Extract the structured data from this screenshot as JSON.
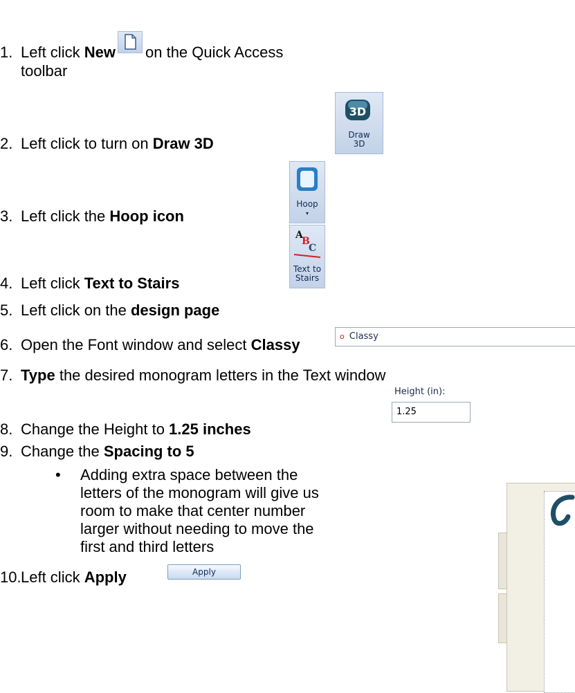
{
  "steps": [
    {
      "num": "1.",
      "pre": "Left click ",
      "bold": "New",
      "post": " on the Quick Access"
    },
    {
      "cont": "toolbar"
    },
    {
      "num": "2.",
      "pre": "Left click to turn on ",
      "bold": "Draw 3D",
      "post": ""
    },
    {
      "num": "3.",
      "pre": "Left click the ",
      "bold": "Hoop icon",
      "post": ""
    },
    {
      "num": "4.",
      "pre": "Left click ",
      "bold": "Text to Stairs",
      "post": ""
    },
    {
      "num": "5.",
      "pre": "Left click on the ",
      "bold": "design page",
      "post": ""
    },
    {
      "num": "6.",
      "pre": "Open the Font window and select ",
      "bold": "Classy",
      "post": ""
    },
    {
      "num": "7.",
      "pre": "",
      "bold": "Type",
      "post": " the desired monogram letters in the Text window"
    },
    {
      "num": "8.",
      "pre": "Change the Height to ",
      "bold": "1.25 inches",
      "post": ""
    },
    {
      "num": "9.",
      "pre": "Change the ",
      "bold": "Spacing to 5",
      "post": ""
    },
    {
      "num": "10.",
      "pre": "Left click ",
      "bold": "Apply",
      "post": ""
    }
  ],
  "bullet": [
    "Adding extra space between the",
    "letters of the monogram will give us",
    "room to make that center number",
    "larger without needing to move the",
    "first and third letters"
  ],
  "icons": {
    "draw3d_label": "Draw",
    "draw3d_label2": "3D",
    "hoop_label": "Hoop",
    "text_stairs_label": "Text to",
    "text_stairs_label2": "Stairs",
    "font_value": "Classy",
    "height_label": "Height (in):",
    "height_value": "1.25",
    "apply_label": "Apply"
  },
  "colors": {
    "ribbon": "#c3d2e8",
    "accent_red": "#cc2222",
    "dark_teal": "#1f4f66"
  }
}
